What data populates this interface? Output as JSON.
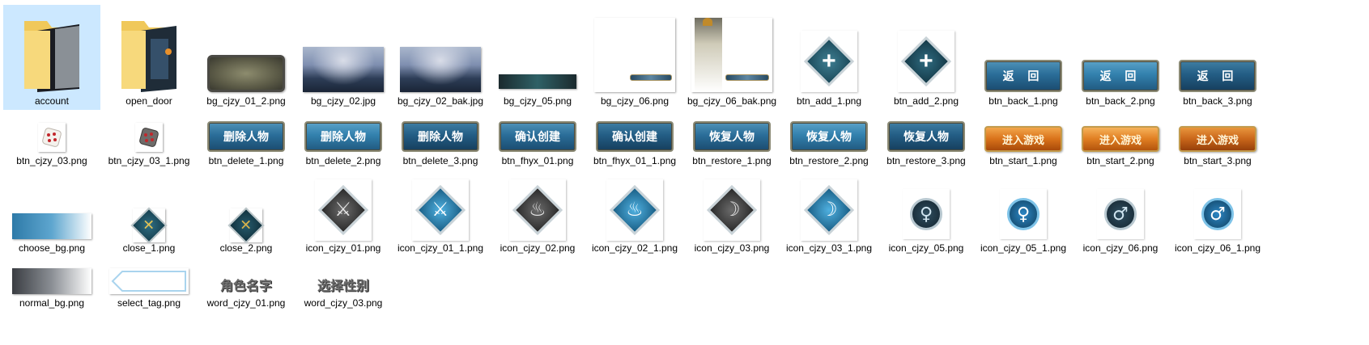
{
  "files": [
    {
      "name": "account",
      "kind": "folder"
    },
    {
      "name": "open_door",
      "kind": "folder"
    },
    {
      "name": "bg_cjzy_01_2.png"
    },
    {
      "name": "bg_cjzy_02.jpg"
    },
    {
      "name": "bg_cjzy_02_bak.jpg"
    },
    {
      "name": "bg_cjzy_05.png"
    },
    {
      "name": "bg_cjzy_06.png"
    },
    {
      "name": "bg_cjzy_06_bak.png"
    },
    {
      "name": "btn_add_1.png"
    },
    {
      "name": "btn_add_2.png"
    },
    {
      "name": "btn_back_1.png",
      "caption": "返 回"
    },
    {
      "name": "btn_back_2.png",
      "caption": "返 回"
    },
    {
      "name": "btn_back_3.png",
      "caption": "返 回"
    },
    {
      "name": "btn_cjzy_03.png"
    },
    {
      "name": "btn_cjzy_03_1.png"
    },
    {
      "name": "btn_delete_1.png",
      "caption": "删除人物"
    },
    {
      "name": "btn_delete_2.png",
      "caption": "删除人物"
    },
    {
      "name": "btn_delete_3.png",
      "caption": "删除人物"
    },
    {
      "name": "btn_fhyx_01.png",
      "caption": "确认创建"
    },
    {
      "name": "btn_fhyx_01_1.png",
      "caption": "确认创建"
    },
    {
      "name": "btn_restore_1.png",
      "caption": "恢复人物"
    },
    {
      "name": "btn_restore_2.png",
      "caption": "恢复人物"
    },
    {
      "name": "btn_restore_3.png",
      "caption": "恢复人物"
    },
    {
      "name": "btn_start_1.png",
      "caption": "进入游戏"
    },
    {
      "name": "btn_start_2.png",
      "caption": "进入游戏"
    },
    {
      "name": "btn_start_3.png",
      "caption": "进入游戏"
    },
    {
      "name": "choose_bg.png"
    },
    {
      "name": "close_1.png"
    },
    {
      "name": "close_2.png"
    },
    {
      "name": "icon_cjzy_01.png"
    },
    {
      "name": "icon_cjzy_01_1.png"
    },
    {
      "name": "icon_cjzy_02.png"
    },
    {
      "name": "icon_cjzy_02_1.png"
    },
    {
      "name": "icon_cjzy_03.png"
    },
    {
      "name": "icon_cjzy_03_1.png"
    },
    {
      "name": "icon_cjzy_05.png",
      "symbol": "♀"
    },
    {
      "name": "icon_cjzy_05_1.png",
      "symbol": "♀"
    },
    {
      "name": "icon_cjzy_06.png",
      "symbol": "♂"
    },
    {
      "name": "icon_cjzy_06_1.png",
      "symbol": "♂"
    },
    {
      "name": "normal_bg.png"
    },
    {
      "name": "select_tag.png"
    },
    {
      "name": "word_cjzy_01.png",
      "caption": "角色名字"
    },
    {
      "name": "word_cjzy_03.png",
      "caption": "选择性别"
    }
  ],
  "selected": "account",
  "colors": {
    "selection": "#cce8ff",
    "button_blue": "#2a6d98",
    "button_orange": "#d9721a",
    "folder": "#f5d67a"
  }
}
